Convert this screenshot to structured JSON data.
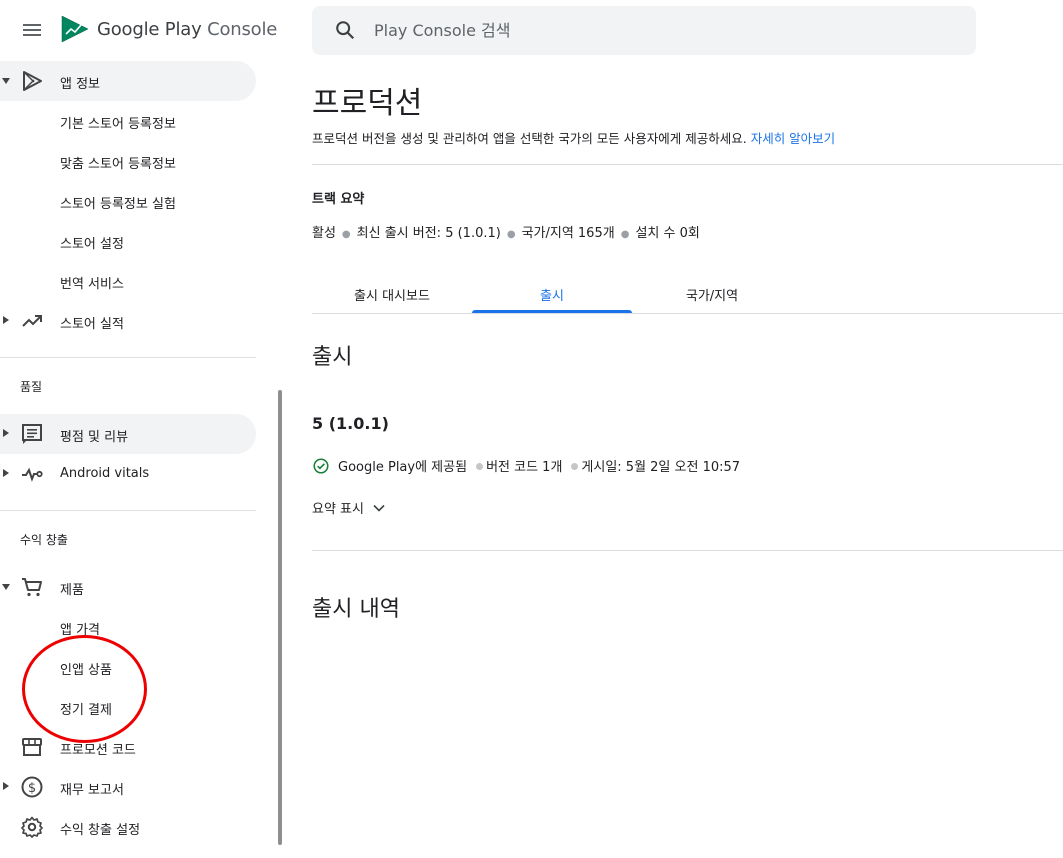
{
  "app": {
    "brand_part1": "Google Play",
    "brand_part2": "Console"
  },
  "search": {
    "placeholder": "Play Console 검색",
    "value": ""
  },
  "sidebar": {
    "app_info": {
      "label": "앱 정보",
      "children": [
        "기본 스토어 등록정보",
        "맞춤 스토어 등록정보",
        "스토어 등록정보 실험",
        "스토어 설정",
        "번역 서비스"
      ]
    },
    "store_performance": {
      "label": "스토어 실적"
    },
    "quality_heading": "품질",
    "ratings_reviews": {
      "label": "평점 및 리뷰"
    },
    "android_vitals": {
      "label": "Android vitals"
    },
    "monetize_heading": "수익 창출",
    "products": {
      "label": "제품",
      "children": [
        "앱 가격",
        "인앱 상품",
        "정기 결제"
      ]
    },
    "promo_codes": {
      "label": "프로모션 코드"
    },
    "financial_reports": {
      "label": "재무 보고서"
    },
    "monetization_settings": {
      "label": "수익 창출 설정"
    }
  },
  "main": {
    "title": "프로덕션",
    "description": "프로덕션 버전을 생성 및 관리하여 앱을 선택한 국가의 모든 사용자에게 제공하세요.",
    "learn_more": "자세히 알아보기",
    "track_summary": {
      "heading": "트랙 요약",
      "status": "활성",
      "latest_release": "최신 출시 버전: 5 (1.0.1)",
      "countries": "국가/지역 165개",
      "installs": "설치 수 0회"
    },
    "tabs": [
      {
        "label": "출시 대시보드",
        "active": false
      },
      {
        "label": "출시",
        "active": true
      },
      {
        "label": "국가/지역",
        "active": false
      }
    ],
    "releases_heading": "출시",
    "release": {
      "version": "5 (1.0.1)",
      "status": "Google Play에 제공됨",
      "version_codes": "버전 코드 1개",
      "published": "게시일: 5월 2일 오전 10:57",
      "show_summary": "요약 표시"
    },
    "history_heading": "출시 내역"
  },
  "colors": {
    "accent": "#1a73e8",
    "success": "#188038",
    "annotation_circle": "#ee0000"
  }
}
